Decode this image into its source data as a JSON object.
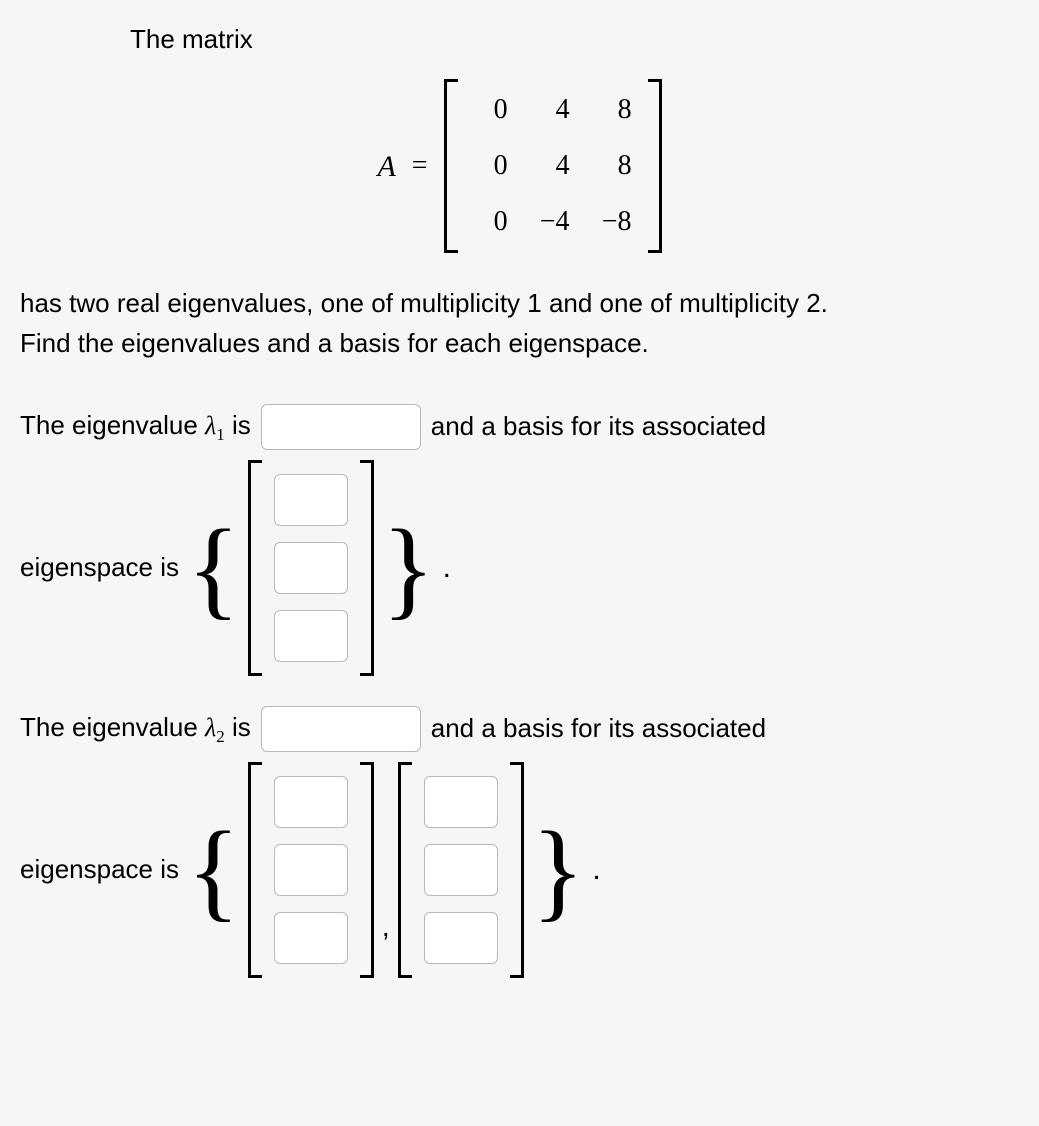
{
  "intro": "The matrix",
  "matrix_label": "A",
  "eq_sign": "=",
  "matrix": {
    "rows": [
      [
        "0",
        "4",
        "8"
      ],
      [
        "0",
        "4",
        "8"
      ],
      [
        "0",
        "−4",
        "−8"
      ]
    ]
  },
  "para_line1": "has two real eigenvalues, one of multiplicity 1 and one of multiplicity 2.",
  "para_line2": "Find the eigenvalues and a basis for each eigenspace.",
  "q1": {
    "prefix": "The eigenvalue ",
    "lambda": "λ",
    "sub": "1",
    "is": " is",
    "suffix": "and a basis for its associated",
    "eigenspace_label": "eigenspace is"
  },
  "q2": {
    "prefix": "The eigenvalue ",
    "lambda": "λ",
    "sub": "2",
    "is": " is",
    "suffix": "and a basis for its associated",
    "eigenspace_label": "eigenspace is"
  },
  "punct": {
    "lbrace": "{",
    "rbrace": "}",
    "period": ".",
    "comma": ","
  }
}
